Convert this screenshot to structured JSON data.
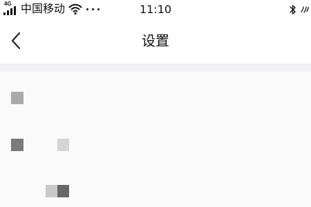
{
  "status_bar": {
    "network_type": "4G",
    "carrier": "中国移动",
    "time": "11:10",
    "icons": {
      "signal": "signal-icon",
      "wifi": "wifi-icon",
      "more": "more-icon",
      "bluetooth": "bluetooth-icon",
      "nfc": "nfc-icon"
    }
  },
  "navigation": {
    "back_icon": "chevron-left-icon",
    "title": "设置"
  },
  "colors": {
    "background": "#f6f6f8",
    "surface": "#ffffff",
    "content_background": "#fbfafb",
    "text": "#111111",
    "pixel_light": "#d5d5d5",
    "pixel_medium": "#aaaaaa",
    "pixel_dark": "#686868"
  }
}
